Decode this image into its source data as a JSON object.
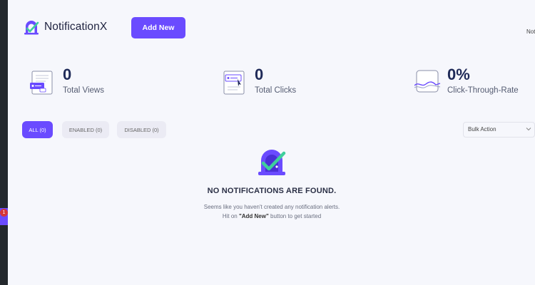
{
  "sidebar": {
    "badge_count": "1"
  },
  "header": {
    "brand": "NotificationX",
    "add_new_label": "Add New",
    "right_text": "Not"
  },
  "stats": [
    {
      "value": "0",
      "label": "Total Views",
      "icon": "views-icon"
    },
    {
      "value": "0",
      "label": "Total Clicks",
      "icon": "clicks-icon"
    },
    {
      "value": "0%",
      "label": "Click-Through-Rate",
      "icon": "ctr-icon"
    }
  ],
  "filters": {
    "all": "ALL (0)",
    "enabled": "ENABLED (0)",
    "disabled": "DISABLED (0)"
  },
  "bulk_action": {
    "selected": "Bulk Action"
  },
  "empty": {
    "title": "NO NOTIFICATIONS ARE FOUND.",
    "line1": "Seems like you haven't created any notification alerts.",
    "line2_pre": "Hit on ",
    "line2_bold": "\"Add New\"",
    "line2_post": " button to get started"
  },
  "colors": {
    "accent": "#6a4bff",
    "check": "#3ecf9c",
    "sidebar": "#23282d"
  }
}
